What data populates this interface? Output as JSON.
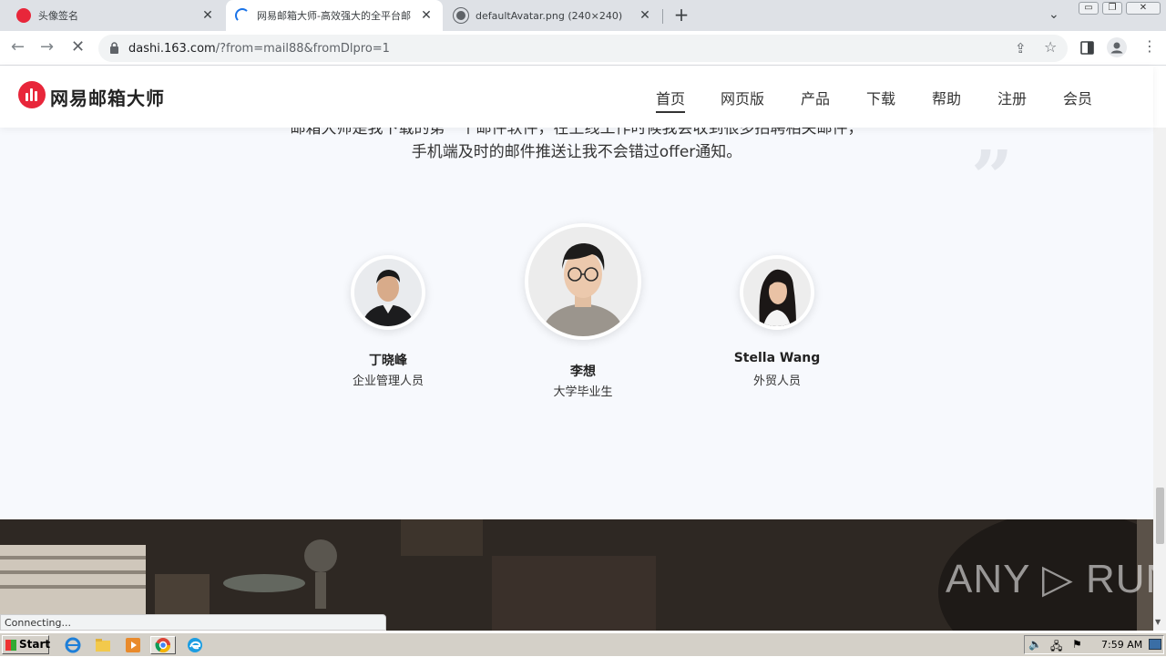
{
  "browser": {
    "tabs": [
      {
        "title": "头像签名",
        "active": false
      },
      {
        "title": "网易邮箱大师-高效强大的全平台邮",
        "active": true
      },
      {
        "title": "defaultAvatar.png (240×240)",
        "active": false
      }
    ],
    "url_host": "dashi.163.com",
    "url_path": "/?from=mail88&fromDlpro=1",
    "new_tab_label": "+",
    "window_controls": {
      "minimize": "▭",
      "restore": "❐",
      "close": "✕"
    }
  },
  "site": {
    "logo_text": "网易邮箱大师",
    "nav": [
      {
        "label": "首页",
        "current": true
      },
      {
        "label": "网页版"
      },
      {
        "label": "产品"
      },
      {
        "label": "下载"
      },
      {
        "label": "帮助"
      },
      {
        "label": "注册"
      },
      {
        "label": "会员"
      }
    ]
  },
  "testimonial": {
    "line_1": "邮箱大师是我下载的第一个邮件软件，在上线工作时候我会收到很多招聘相关邮件，",
    "line_2": "手机端及时的邮件推送让我不会错过offer通知。",
    "quote_mark": "”",
    "people": [
      {
        "name": "丁晓峰",
        "role": "企业管理人员"
      },
      {
        "name": "李想",
        "role": "大学毕业生"
      },
      {
        "name": "Stella Wang",
        "role": "外贸人员"
      }
    ]
  },
  "banner": {
    "watermark": "ANY ▷ RUN"
  },
  "status_bar": "Connecting...",
  "taskbar": {
    "start_label": "Start",
    "clock": "7:59 AM"
  },
  "colors": {
    "brand": "#e8263a",
    "page_bg": "#f7f9fd"
  }
}
